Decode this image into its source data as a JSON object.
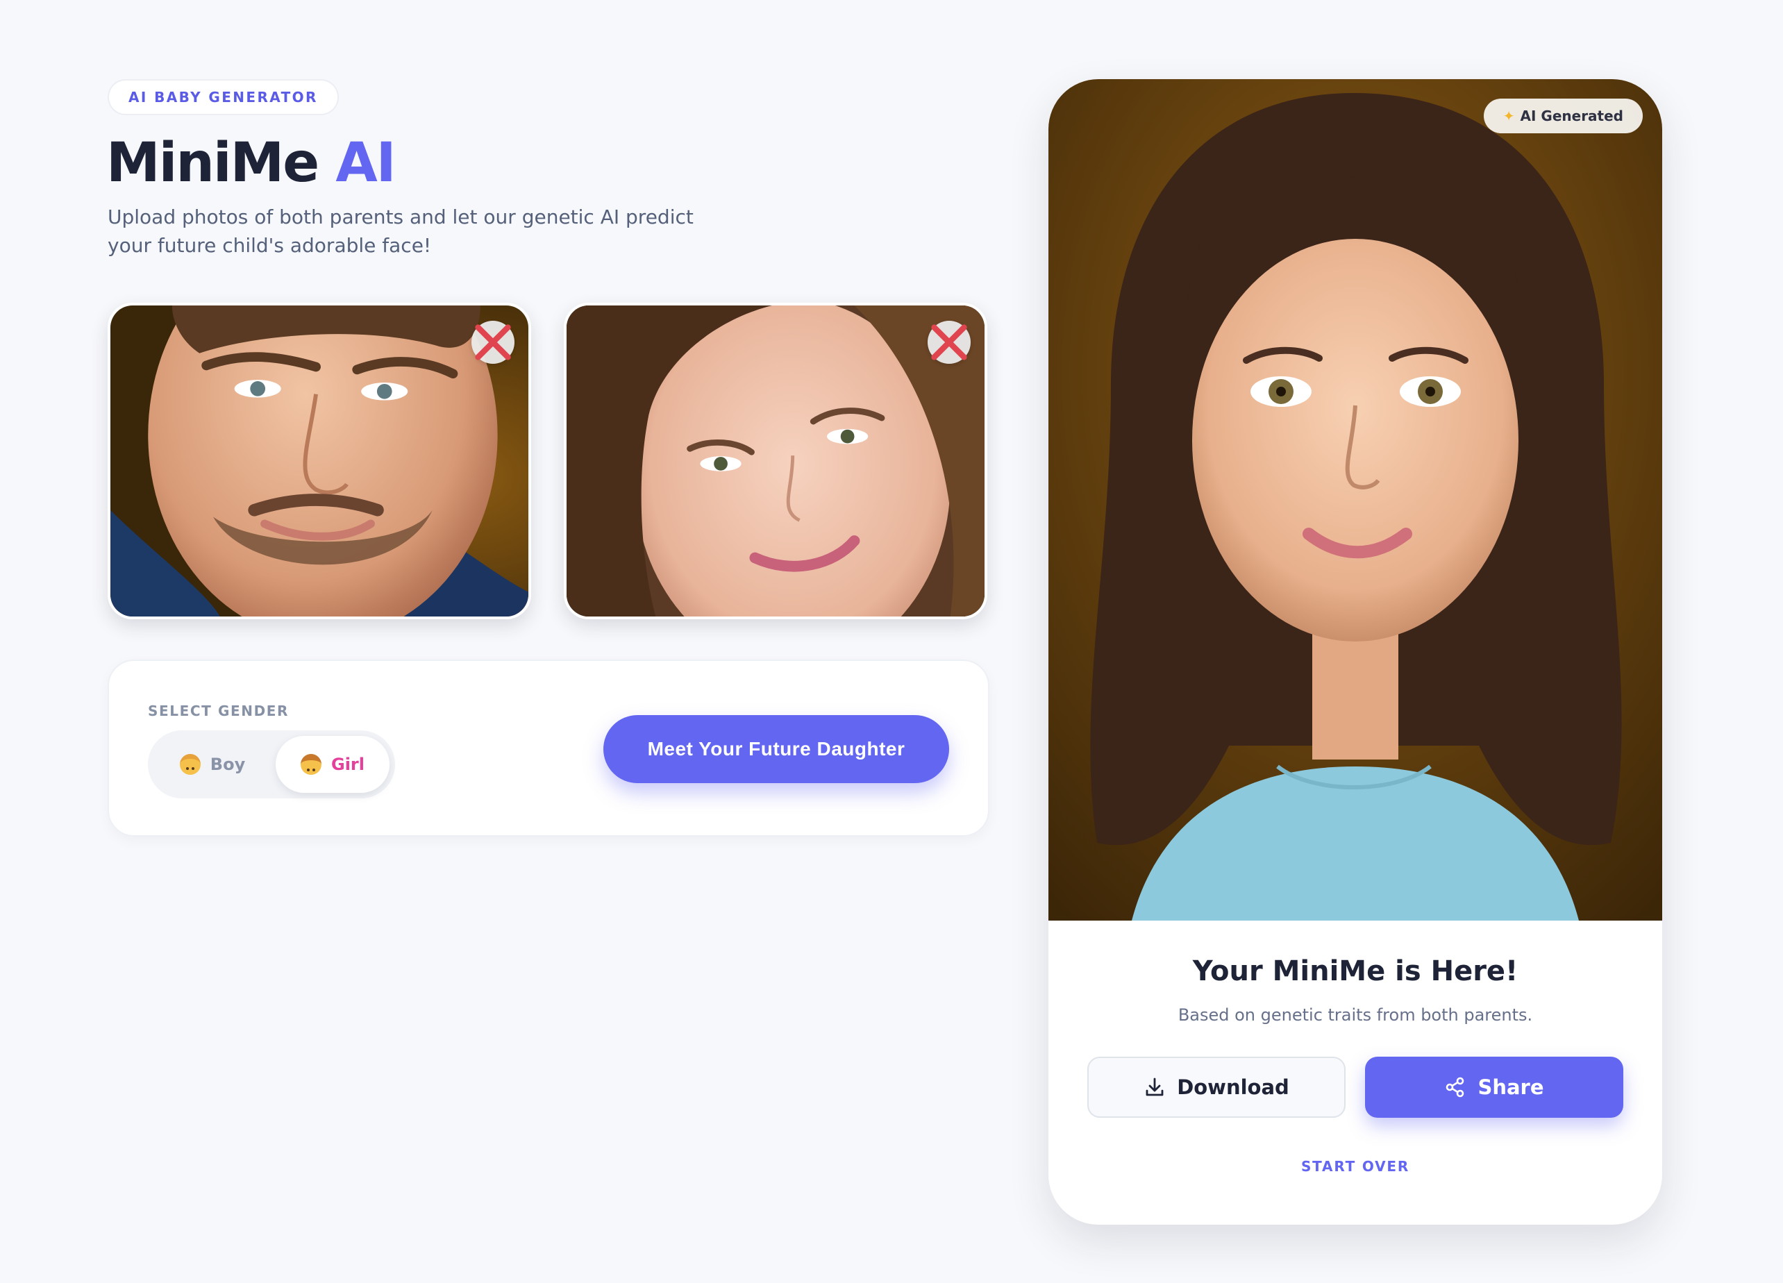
{
  "header": {
    "badge": "AI BABY GENERATOR",
    "title_main": "MiniMe",
    "title_accent": "AI",
    "subtitle": "Upload photos of both parents and let our genetic AI predict your future child's adorable face!"
  },
  "parents": {
    "father": {
      "photo": "father-photo",
      "remove_icon": "close-icon"
    },
    "mother": {
      "photo": "mother-photo",
      "remove_icon": "close-icon"
    }
  },
  "controls": {
    "gender_label": "SELECT GENDER",
    "options": [
      {
        "label": "Boy",
        "icon": "boy-emoji-icon",
        "selected": false
      },
      {
        "label": "Girl",
        "icon": "girl-emoji-icon",
        "selected": true
      }
    ],
    "cta_label": "Meet Your Future Daughter"
  },
  "result": {
    "tag": "AI Generated",
    "tag_icon": "sparkles-icon",
    "title": "Your MiniMe is Here!",
    "subtitle": "Based on genetic traits from both parents.",
    "download_label": "Download",
    "download_icon": "download-icon",
    "share_label": "Share",
    "share_icon": "share-icon",
    "start_over": "START OVER"
  },
  "colors": {
    "accent": "#6366f1",
    "girl": "#e5409a",
    "background": "#f7f8fb",
    "remove": "#e0454f"
  }
}
